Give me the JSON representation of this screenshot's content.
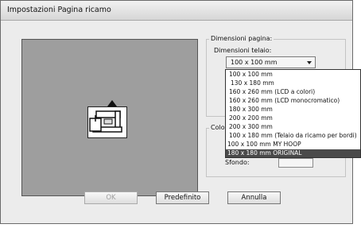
{
  "window": {
    "title": "Impostazioni Pagina ricamo"
  },
  "page_dimensions": {
    "group_label": "Dimensioni pagina:",
    "frame_label": "Dimensioni telaio:",
    "selected_value": "100 x 100 mm"
  },
  "frame_options": [
    "100 x 100 mm",
    "130 x 180 mm",
    "160 x 260 mm (LCD a colori)",
    "160 x 260 mm (LCD monocromatico)",
    "180 x 300 mm",
    "200 x 200 mm",
    "200 x 300 mm",
    "100 x 180 mm (Telaio da ricamo per bordi)",
    "100 x 100 mm MY HOOP",
    "180 x 180 mm ORIGINAL"
  ],
  "highlighted_option_index": 9,
  "color_section": {
    "label_partial": "Colo",
    "background_label": "Sfondo:"
  },
  "buttons": {
    "ok": "OK",
    "default": "Predefinito",
    "cancel": "Annulla"
  }
}
